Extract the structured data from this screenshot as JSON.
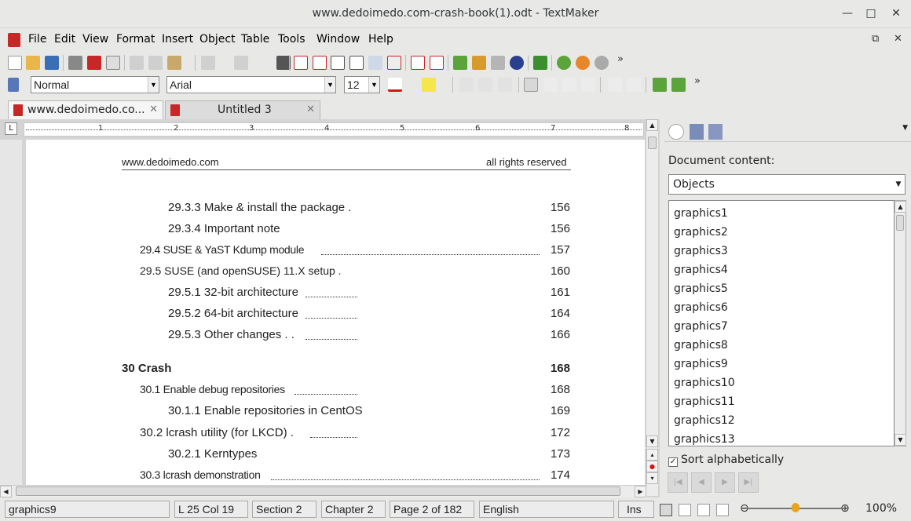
{
  "window": {
    "title": "www.dedoimedo.com-crash-book(1).odt - TextMaker",
    "minimize": "—",
    "maximize": "□",
    "close": "✕"
  },
  "menu": [
    "File",
    "Edit",
    "View",
    "Format",
    "Insert",
    "Object",
    "Table",
    "Tools",
    "Window",
    "Help"
  ],
  "format_bar": {
    "style": "Normal",
    "font": "Arial",
    "size": "12"
  },
  "tabs": [
    {
      "label": "www.dedoimedo.co...",
      "close": "✕"
    },
    {
      "label": "Untitled 3",
      "close": "✕"
    }
  ],
  "ruler": {
    "corner": "L",
    "numbers": [
      "1",
      "2",
      "3",
      "4",
      "5",
      "6",
      "7",
      "8"
    ]
  },
  "page": {
    "header_left": "www.dedoimedo.com",
    "header_right": "all rights reserved",
    "toc": [
      {
        "text": "29.3.3 Make & install the package  .",
        "page": "156"
      },
      {
        "text": "29.3.4 Important note",
        "page": "156"
      },
      {
        "text": "29.4  SUSE & YaST Kdump module",
        "page": "157"
      },
      {
        "text": "29.5  SUSE (and openSUSE) 11.X setup   .",
        "page": "160"
      },
      {
        "text": "29.5.1 32-bit architecture",
        "page": "161"
      },
      {
        "text": "29.5.2 64-bit architecture",
        "page": "164"
      },
      {
        "text": "29.5.3 Other changes  .  .",
        "page": "166"
      },
      {
        "text": "30  Crash",
        "page": "168"
      },
      {
        "text": "30.1  Enable debug repositories",
        "page": "168"
      },
      {
        "text": "30.1.1 Enable repositories in CentOS",
        "page": "169"
      },
      {
        "text": "30.2  lcrash utility (for LKCD) .",
        "page": "172"
      },
      {
        "text": "30.2.1 Kerntypes",
        "page": "173"
      },
      {
        "text": "30.3  lcrash demonstration",
        "page": "174"
      }
    ]
  },
  "sidebar": {
    "label": "Document content:",
    "filter": "Objects",
    "objects": [
      "graphics1",
      "graphics2",
      "graphics3",
      "graphics4",
      "graphics5",
      "graphics6",
      "graphics7",
      "graphics8",
      "graphics9",
      "graphics10",
      "graphics11",
      "graphics12",
      "graphics13"
    ],
    "sort_label": "Sort alphabetically",
    "sort_checked": "✓"
  },
  "status": {
    "object": "graphics9",
    "position": "L 25 Col 19",
    "section": "Section 2",
    "chapter": "Chapter 2",
    "page": "Page 2 of 182",
    "language": "English",
    "mode": "Ins",
    "zoom": "100%"
  }
}
